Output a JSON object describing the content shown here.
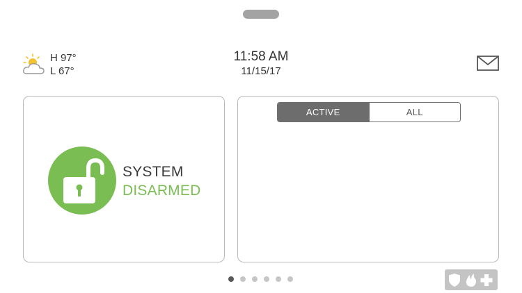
{
  "header": {
    "weather": {
      "icon": "partly-cloudy-icon",
      "high": "H 97°",
      "low": "L 67°"
    },
    "time": "11:58 AM",
    "date": "11/15/17",
    "messages_icon": "envelope-icon"
  },
  "security": {
    "status_line1": "SYSTEM",
    "status_line2": "DISARMED",
    "icon": "unlocked-padlock-icon",
    "accent_color": "#7abd53"
  },
  "sensors": {
    "filter": {
      "active_label": "ACTIVE",
      "all_label": "ALL",
      "selected": "ACTIVE"
    }
  },
  "pagination": {
    "page_count": 6,
    "current_page": 1
  },
  "emergency": {
    "icons": [
      "shield-icon",
      "fire-icon",
      "medical-cross-icon"
    ]
  }
}
